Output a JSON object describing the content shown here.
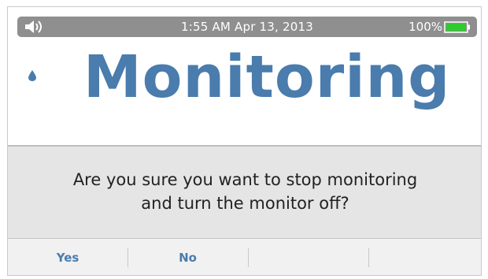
{
  "status_bar": {
    "time_date": "1:55 AM  Apr 13, 2013",
    "battery_percent": "100%",
    "battery_level": 1.0,
    "speaker_icon": "speaker-volume-icon",
    "battery_icon": "battery-full-icon"
  },
  "header": {
    "title": "Monitoring",
    "drop_icon": "water-drop-icon"
  },
  "dialog": {
    "message_line1": "Are you sure you want to stop monitoring",
    "message_line2": "and turn the monitor off?"
  },
  "buttons": {
    "yes_label": "Yes",
    "no_label": "No",
    "slot3_label": "",
    "slot4_label": ""
  },
  "colors": {
    "accent": "#4a7cad",
    "status_bar": "#8f8f8f",
    "battery": "#2ecc2e",
    "panel": "#e5e5e5"
  }
}
